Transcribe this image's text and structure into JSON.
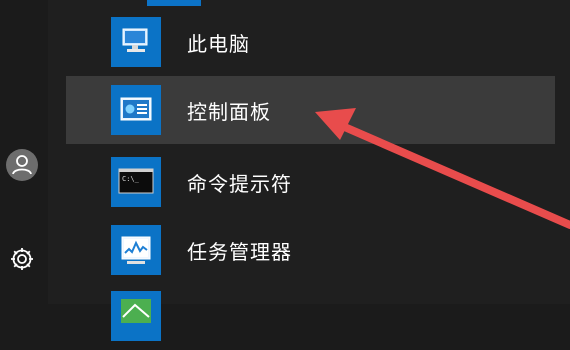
{
  "start_menu": {
    "items": [
      {
        "label": "此电脑",
        "icon": "this-pc-icon"
      },
      {
        "label": "控制面板",
        "icon": "control-panel-icon",
        "highlighted": true
      },
      {
        "label": "命令提示符",
        "icon": "command-prompt-icon"
      },
      {
        "label": "任务管理器",
        "icon": "task-manager-icon"
      },
      {
        "label": "",
        "icon": "partial-app-icon"
      }
    ]
  },
  "left_rail": {
    "icons": [
      "user-avatar-icon",
      "settings-gear-icon"
    ]
  },
  "colors": {
    "tile": "#0b73c6",
    "hover_row": "#3b3b3b",
    "background": "#1f1f1f",
    "annotation_arrow": "#e84c4c"
  }
}
